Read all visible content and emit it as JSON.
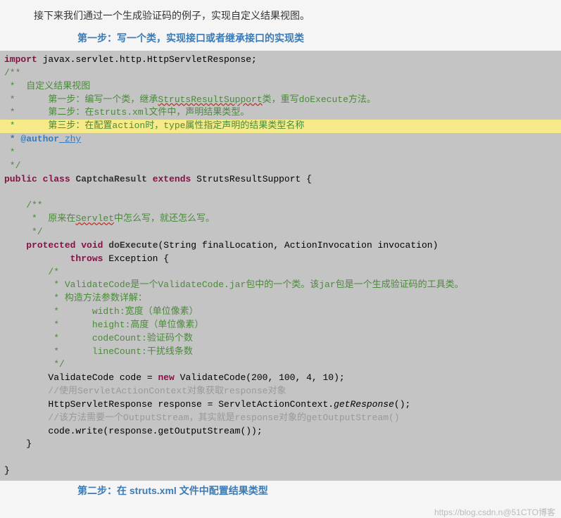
{
  "intro": "接下来我们通过一个生成验证码的例子，实现自定义结果视图。",
  "step1_header": "第一步：写一个类，实现接口或者继承接口的实现类",
  "code": {
    "import_kw": "import",
    "import_pkg": " javax.servlet.http.HttpServletResponse;",
    "c_open": "/**",
    "c_l1": " *  自定义结果视图",
    "c_l2_pre": " *      第一步：编写一个类，继承",
    "c_l2_cls": "StrutsResultSupport",
    "c_l2_post": "类，重写doExecute方法。",
    "c_l3": " *      第二步：在struts.xml文件中，声明结果类型。",
    "c_l4": " *      第三步：在配置action时，type属性指定声明的结果类型名称",
    "c_author_tag": " * @author",
    "c_author_name": " zhy",
    "c_l5": " *",
    "c_close": " */",
    "public_kw": "public",
    "class_kw": "class",
    "class_name": "CaptchaResult",
    "extends_kw": "extends",
    "super_name": "StrutsResultSupport {",
    "m_c_open": "    /**",
    "m_c_l1_pre": "     *  原来在",
    "m_c_l1_servlet": "Servlet",
    "m_c_l1_post": "中怎么写，就还怎么写。",
    "m_c_close": "     */",
    "protected_kw": "protected",
    "void_kw": "void",
    "method_name": "doExecute",
    "method_params": "(String finalLocation, ActionInvocation invocation)",
    "throws_kw": "throws",
    "exception_name": "Exception {",
    "b_c_open": "        /*",
    "b_c_l1": "         * ValidateCode是一个ValidateCode.jar包中的一个类。该jar包是一个生成验证码的工具类。",
    "b_c_l2": "         * 构造方法参数详解：",
    "b_c_l3": "         *      width:宽度（单位像素）",
    "b_c_l4": "         *      height:高度（单位像素）",
    "b_c_l5": "         *      codeCount:验证码个数",
    "b_c_l6": "         *      lineCount:干扰线条数",
    "b_c_close": "         */",
    "vc_line_pre": "        ValidateCode code = ",
    "new_kw": "new",
    "vc_line_post": " ValidateCode(200, 100, 4, 10);",
    "cmt1": "        //使用ServletActionContext对象获取response对象",
    "resp_line_pre": "        HttpServletResponse response = ServletActionContext.",
    "resp_line_method": "getResponse",
    "resp_line_post": "();",
    "cmt2": "        //该方法需要一个OutputStream，其实就是response对象的getOutputStream()",
    "write_line": "        code.write(response.getOutputStream());",
    "method_close": "    }",
    "class_close": "}"
  },
  "step2_header": "第二步：在 struts.xml 文件中配置结果类型",
  "watermark": "https://blog.csdn.n@51CTO博客"
}
